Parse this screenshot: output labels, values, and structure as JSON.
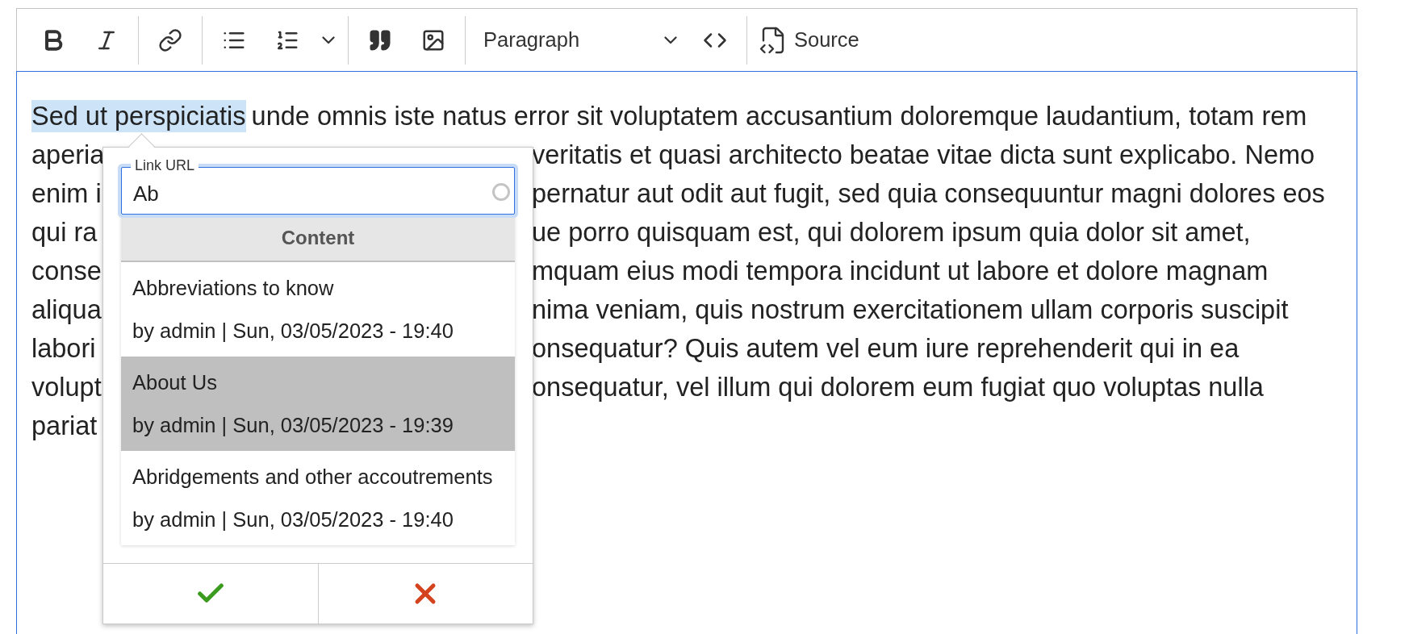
{
  "toolbar": {
    "items": [
      {
        "kind": "bold"
      },
      {
        "kind": "italic"
      },
      {
        "kind": "separator"
      },
      {
        "kind": "link"
      },
      {
        "kind": "separator"
      },
      {
        "kind": "bulleted"
      },
      {
        "kind": "numbered"
      },
      {
        "kind": "caret"
      },
      {
        "kind": "separator"
      },
      {
        "kind": "quote"
      },
      {
        "kind": "image"
      },
      {
        "kind": "separator"
      },
      {
        "kind": "heading",
        "label": "Paragraph"
      },
      {
        "kind": "code"
      },
      {
        "kind": "separator"
      },
      {
        "kind": "source",
        "label": "Source"
      }
    ]
  },
  "editor": {
    "selection": "Sed ut perspiciatis",
    "first_line_rest": "unde omnis iste natus error sit voluptatem accusantium doloremque laudantium, totam rem",
    "lines": [
      {
        "left": "aperia",
        "right": "veritatis et quasi architecto beatae vitae dicta sunt explicabo. Nemo"
      },
      {
        "left": "enim i",
        "right": "pernatur aut odit aut fugit, sed quia consequuntur magni dolores eos"
      },
      {
        "left": "qui ra",
        "right": "ue porro quisquam est, qui dolorem ipsum quia dolor sit amet,"
      },
      {
        "left": "conse",
        "right": "mquam eius modi tempora incidunt ut labore et dolore magnam"
      },
      {
        "left": "aliqua",
        "right": "nima veniam, quis nostrum exercitationem ullam corporis suscipit"
      },
      {
        "left": "labori",
        "right": "onsequatur? Quis autem vel eum iure reprehenderit qui in ea"
      },
      {
        "left": "volupt",
        "right": "onsequatur, vel illum qui dolorem eum fugiat quo voluptas nulla"
      },
      {
        "left": "pariat"
      }
    ]
  },
  "link_popup": {
    "field": {
      "label": "Link URL",
      "value": "Ab"
    },
    "group_header": "Content",
    "results": [
      {
        "title": "Abbreviations to know",
        "meta": "by admin | Sun, 03/05/2023 - 19:40",
        "selected": false
      },
      {
        "title": "About Us",
        "meta": "by admin | Sun, 03/05/2023 - 19:39",
        "selected": true
      },
      {
        "title": "Abridgements and other accoutrements",
        "meta": "by admin | Sun, 03/05/2023 - 19:40",
        "selected": false
      }
    ],
    "buttons": [
      {
        "kind": "save"
      },
      {
        "kind": "cancel"
      }
    ]
  }
}
